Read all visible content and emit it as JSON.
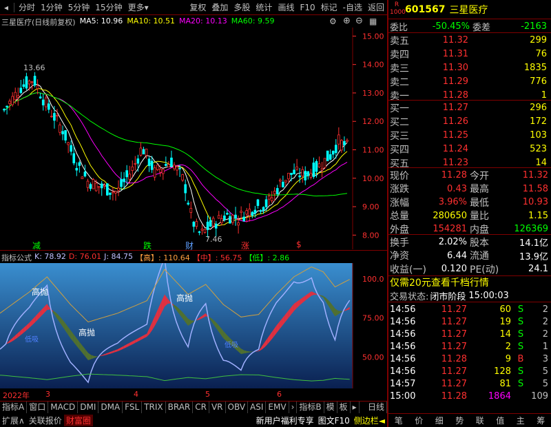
{
  "toolbar": {
    "items": [
      "分时",
      "1分钟",
      "5分钟",
      "15分钟",
      "更多"
    ],
    "right_items": [
      "复权",
      "叠加",
      "多股",
      "统计",
      "画线",
      "F10",
      "标记",
      "-自选",
      "返回"
    ]
  },
  "chart_legend": {
    "name": "三星医疗(日线前复权)",
    "ma5": "MA5: 10.96",
    "ma10": "MA10: 10.51",
    "ma20": "MA20: 10.13",
    "ma60": "MA60: 9.59"
  },
  "chart_annotations": {
    "high": "13.66",
    "low": "7.46",
    "markers": [
      "减",
      "跌",
      "财",
      "涨",
      "$"
    ]
  },
  "colors": {
    "ma5": "#ffffff",
    "ma10": "#ffff00",
    "ma20": "#ff00ff",
    "ma60": "#00ff00",
    "up": "#ff3030",
    "down": "#00ffff",
    "accent": "#ff3030"
  },
  "chart_data": [
    {
      "type": "candlestick",
      "ylim": [
        7.5,
        15.3
      ],
      "yticks": [
        "15.00",
        "14.00",
        "13.00",
        "12.00",
        "11.00",
        "10.00",
        "9.00",
        "8.00"
      ],
      "xticks": [
        "2022年",
        "3",
        "4",
        "5",
        "6"
      ]
    },
    {
      "type": "line",
      "ylim": [
        30,
        110
      ],
      "yticks": [
        "100.0",
        "75.00",
        "50.00"
      ],
      "series_labels": [
        "高抛",
        "高抛",
        "高抛",
        "低吸",
        "低吸"
      ]
    }
  ],
  "indicator_legend": {
    "name": "指标公式",
    "k": "K: 78.92",
    "d": "D: 76.01",
    "j": "J: 84.75",
    "high": "【高】: 110.64",
    "mid": "【中】: 56.75",
    "low": "【低】: 2.86"
  },
  "stock": {
    "code": "601567",
    "name": "三星医疗",
    "badge_top": "R",
    "badge_bottom": "1000"
  },
  "order_book": {
    "ratio_label": "委比",
    "ratio": "-50.45%",
    "diff_label": "委差",
    "diff": "-2163",
    "asks": [
      {
        "label": "卖五",
        "price": "11.32",
        "vol": "299"
      },
      {
        "label": "卖四",
        "price": "11.31",
        "vol": "76"
      },
      {
        "label": "卖三",
        "price": "11.30",
        "vol": "1835"
      },
      {
        "label": "卖二",
        "price": "11.29",
        "vol": "776"
      },
      {
        "label": "卖一",
        "price": "11.28",
        "vol": "1"
      }
    ],
    "bids": [
      {
        "label": "买一",
        "price": "11.27",
        "vol": "296"
      },
      {
        "label": "买二",
        "price": "11.26",
        "vol": "172"
      },
      {
        "label": "买三",
        "price": "11.25",
        "vol": "103"
      },
      {
        "label": "买四",
        "price": "11.24",
        "vol": "523"
      },
      {
        "label": "买五",
        "price": "11.23",
        "vol": "14"
      }
    ]
  },
  "quote": [
    {
      "l1": "现价",
      "v1": "11.28",
      "l2": "今开",
      "v2": "11.32"
    },
    {
      "l1": "涨跌",
      "v1": "0.43",
      "l2": "最高",
      "v2": "11.58"
    },
    {
      "l1": "涨幅",
      "v1": "3.96%",
      "l2": "最低",
      "v2": "10.93"
    },
    {
      "l1": "总量",
      "v1": "280650",
      "l2": "量比",
      "v2": "1.15"
    },
    {
      "l1": "外盘",
      "v1": "154281",
      "l2": "内盘",
      "v2": "126369"
    }
  ],
  "fundamentals": [
    {
      "l1": "换手",
      "v1": "2.02%",
      "l2": "股本",
      "v2": "14.1亿"
    },
    {
      "l1": "净资",
      "v1": "6.44",
      "l2": "流通",
      "v2": "13.9亿"
    },
    {
      "l1": "收益(一)",
      "v1": "0.120",
      "l2": "PE(动)",
      "v2": "24.1"
    }
  ],
  "promo": "仅需20元查看千档行情",
  "trade_status": {
    "label": "交易状态:",
    "value": "闭市阶段",
    "time": "15:00:03"
  },
  "ticks": [
    {
      "time": "14:56",
      "price": "11.27",
      "vol": "60",
      "side": "S",
      "n": "2"
    },
    {
      "time": "14:56",
      "price": "11.27",
      "vol": "19",
      "side": "S",
      "n": "2"
    },
    {
      "time": "14:56",
      "price": "11.27",
      "vol": "14",
      "side": "S",
      "n": "2"
    },
    {
      "time": "14:56",
      "price": "11.27",
      "vol": "2",
      "side": "S",
      "n": "1"
    },
    {
      "time": "14:56",
      "price": "11.28",
      "vol": "9",
      "side": "B",
      "n": "3"
    },
    {
      "time": "14:56",
      "price": "11.27",
      "vol": "128",
      "side": "S",
      "n": "5"
    },
    {
      "time": "14:57",
      "price": "11.27",
      "vol": "81",
      "side": "S",
      "n": "5"
    },
    {
      "time": "15:00",
      "price": "11.28",
      "vol": "1864",
      "side": "",
      "n": "109"
    }
  ],
  "bottom_tabs": [
    "指标A",
    "窗口",
    "MACD",
    "DMI",
    "DMA",
    "FSL",
    "TRIX",
    "BRAR",
    "CR",
    "VR",
    "OBV",
    "ASI",
    "EMV",
    "›",
    "指标B",
    "模",
    "板",
    "▸"
  ],
  "period_label": "日线",
  "status_items": [
    "扩展∧",
    "关联报价",
    "财富圈"
  ],
  "status_right": [
    "新用户福利专享",
    "图文F10",
    "侧边栏◄"
  ],
  "rp_bottom": [
    "笔",
    "价",
    "细",
    "势",
    "联",
    "值",
    "主",
    "筹"
  ]
}
